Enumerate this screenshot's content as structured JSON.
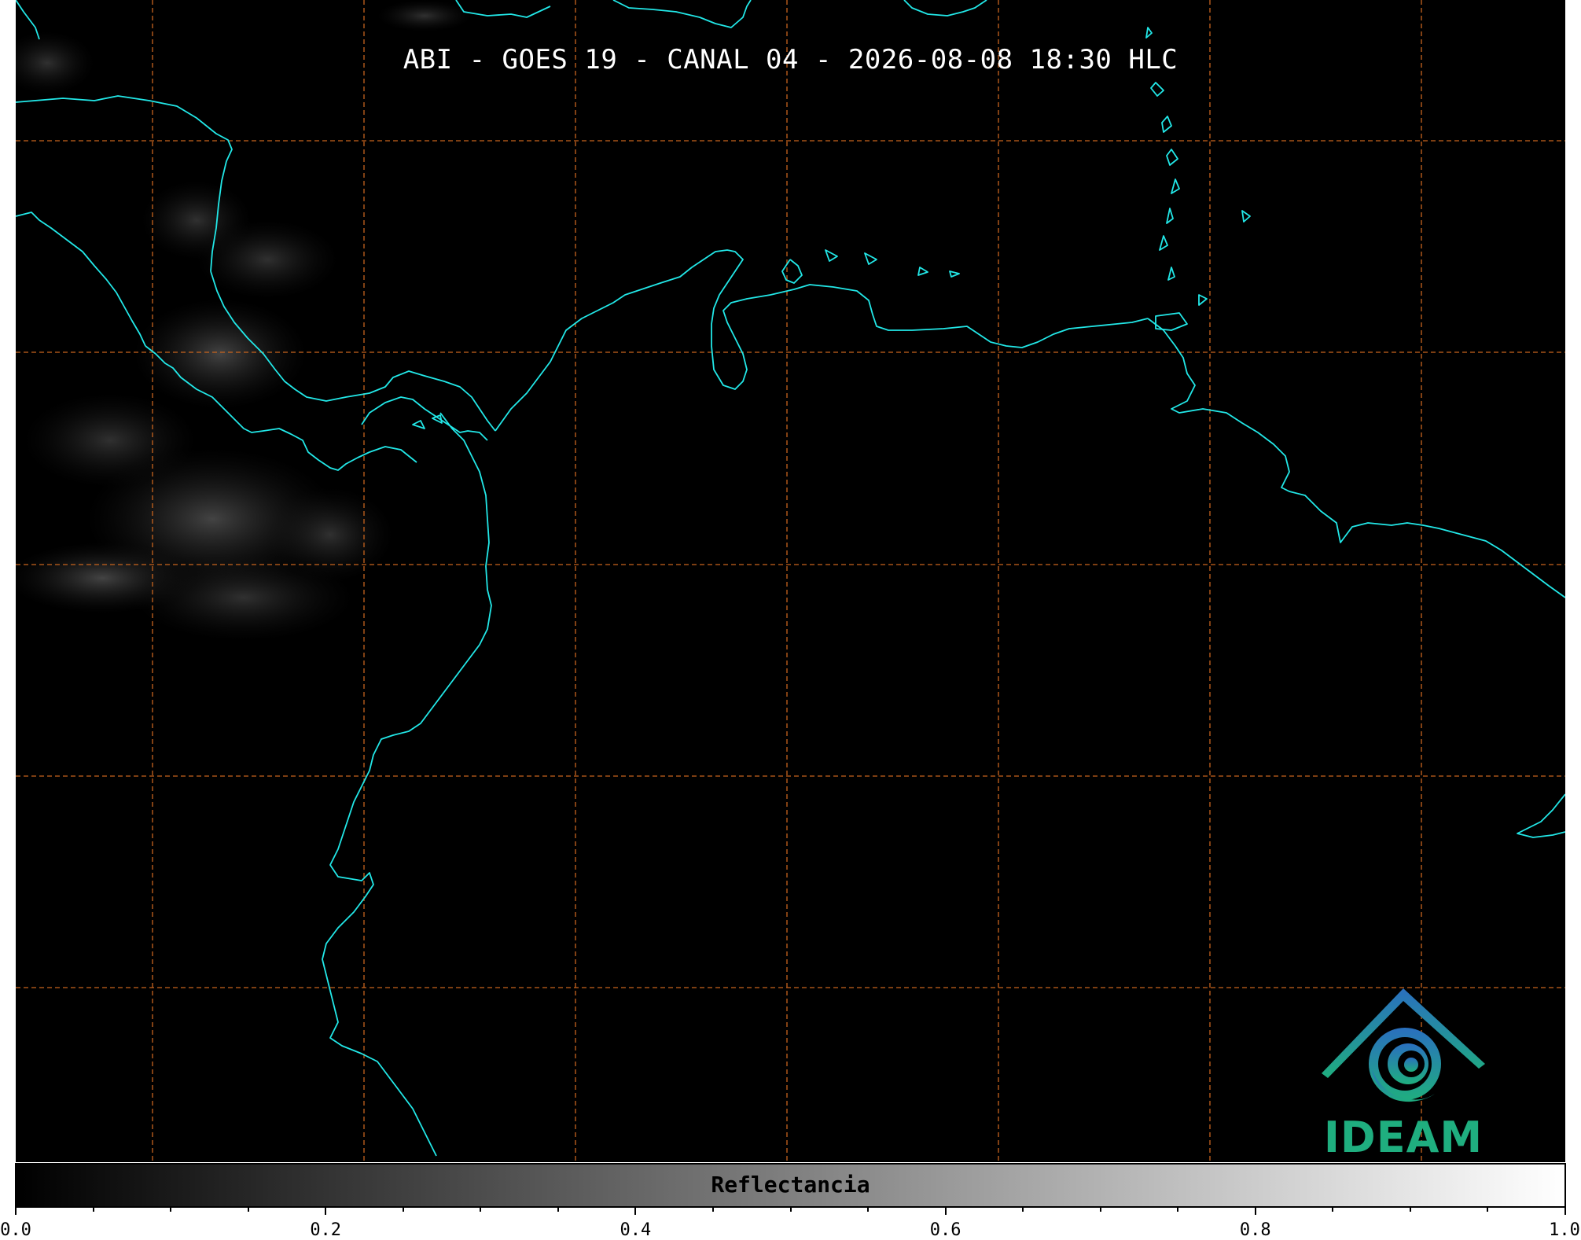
{
  "map": {
    "title": "ABI - GOES 19 - CANAL 04 - 2026-08-08 18:30 HLC",
    "background_color": "#000000",
    "coastline_color": "#22e8e8",
    "gridline_color": "#c8641e",
    "gridline_style": "dashed"
  },
  "colorbar": {
    "label": "Reflectancia",
    "min": 0.0,
    "max": 1.0,
    "colormap": "grayscale",
    "ticks": [
      "0.0",
      "0.2",
      "0.4",
      "0.6",
      "0.8",
      "1.0"
    ],
    "minor_tick_step": 0.05
  },
  "logo": {
    "text": "IDEAM",
    "text_color": "#1fae7f",
    "icon_color_top": "#2a6fbf",
    "icon_color_bottom": "#1fae7f"
  }
}
